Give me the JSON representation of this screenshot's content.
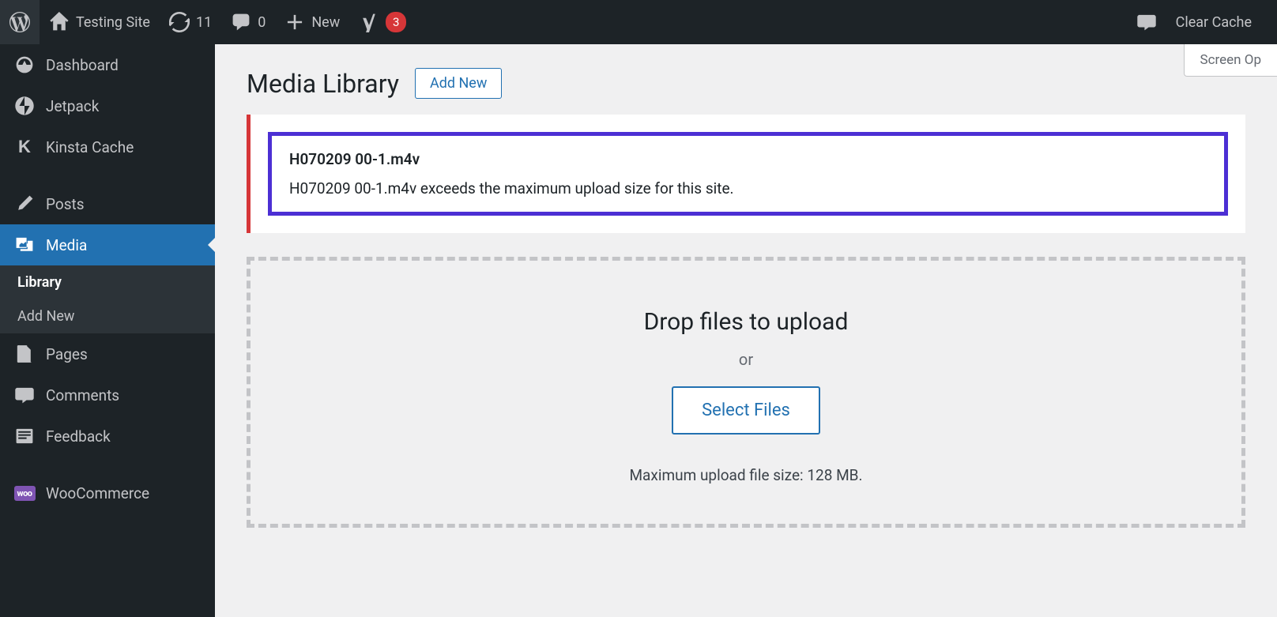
{
  "admin_bar": {
    "site_name": "Testing Site",
    "updates_count": "11",
    "comments_count": "0",
    "new_label": "New",
    "yoast_count": "3",
    "clear_cache": "Clear Cache"
  },
  "sidebar": {
    "dashboard": "Dashboard",
    "jetpack": "Jetpack",
    "kinsta": "Kinsta Cache",
    "posts": "Posts",
    "media": "Media",
    "library": "Library",
    "add_new": "Add New",
    "pages": "Pages",
    "comments": "Comments",
    "feedback": "Feedback",
    "woocommerce": "WooCommerce"
  },
  "main": {
    "screen_options": "Screen Op",
    "page_title": "Media Library",
    "add_new_button": "Add New",
    "error": {
      "filename": "H070209 00-1.m4v",
      "message": "H070209 00-1.m4v exceeds the maximum upload size for this site."
    },
    "upload": {
      "title": "Drop files to upload",
      "or": "or",
      "select_button": "Select Files",
      "max_size": "Maximum upload file size: 128 MB."
    }
  }
}
